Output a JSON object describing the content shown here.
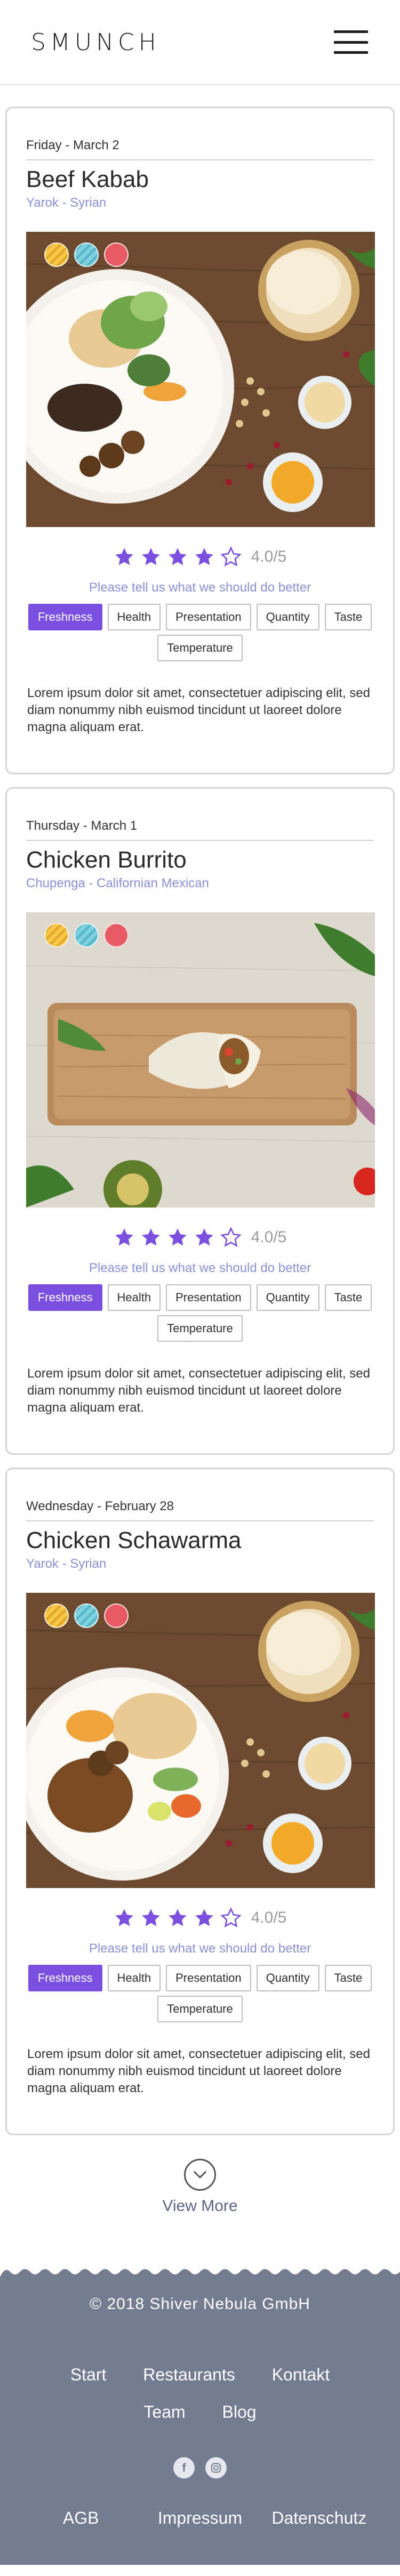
{
  "header": {
    "brand": "SMUNCH",
    "menu_icon": "hamburger-menu-icon"
  },
  "cards": [
    {
      "date": "Friday - March 2",
      "title": "Beef Kabab",
      "subtitle": "Yarok - Syrian",
      "rating": "4.0/5",
      "stars_filled": 4,
      "prompt": "Please tell us what we should do better",
      "chips": [
        "Freshness",
        "Health",
        "Presentation",
        "Quantity",
        "Taste",
        "Temperature"
      ],
      "active_chip": "Freshness",
      "comment": "Lorem ipsum dolor sit amet, consectetuer adipiscing elit, sed diam nonummy nibh euismod tincidunt ut laoreet dolore magna aliquam erat."
    },
    {
      "date": "Thursday - March 1",
      "title": "Chicken Burrito",
      "subtitle": "Chupenga - Californian Mexican",
      "rating": "4.0/5",
      "stars_filled": 4,
      "prompt": "Please tell us what we should do better",
      "chips": [
        "Freshness",
        "Health",
        "Presentation",
        "Quantity",
        "Taste",
        "Temperature"
      ],
      "active_chip": "Freshness",
      "comment": "Lorem ipsum dolor sit amet, consectetuer adipiscing elit, sed diam nonummy nibh euismod tincidunt ut laoreet dolore magna aliquam erat."
    },
    {
      "date": "Wednesday - February 28",
      "title": "Chicken Schawarma",
      "subtitle": "Yarok - Syrian",
      "rating": "4.0/5",
      "stars_filled": 4,
      "prompt": "Please tell us what we should do better",
      "chips": [
        "Freshness",
        "Health",
        "Presentation",
        "Quantity",
        "Taste",
        "Temperature"
      ],
      "active_chip": "Freshness",
      "comment": "Lorem ipsum dolor sit amet, consectetuer adipiscing elit, sed diam nonummy nibh euismod tincidunt ut laoreet dolore magna aliquam erat."
    }
  ],
  "view_more": "View More",
  "footer": {
    "copyright": "© 2018 Shiver Nebula GmbH",
    "nav": [
      "Start",
      "Restaurants",
      "Kontakt",
      "Team",
      "Blog"
    ],
    "social": [
      "facebook-icon",
      "instagram-icon"
    ],
    "legal": [
      "AGB",
      "Impressum",
      "Datenschutz"
    ]
  },
  "colors": {
    "accent": "#7b4fe0",
    "subtitle": "#8a8fd6",
    "footer": "#747c91",
    "tag_red": "#e85a64",
    "tag_yellow": "#f6c94a",
    "tag_blue": "#7fd2e0"
  }
}
